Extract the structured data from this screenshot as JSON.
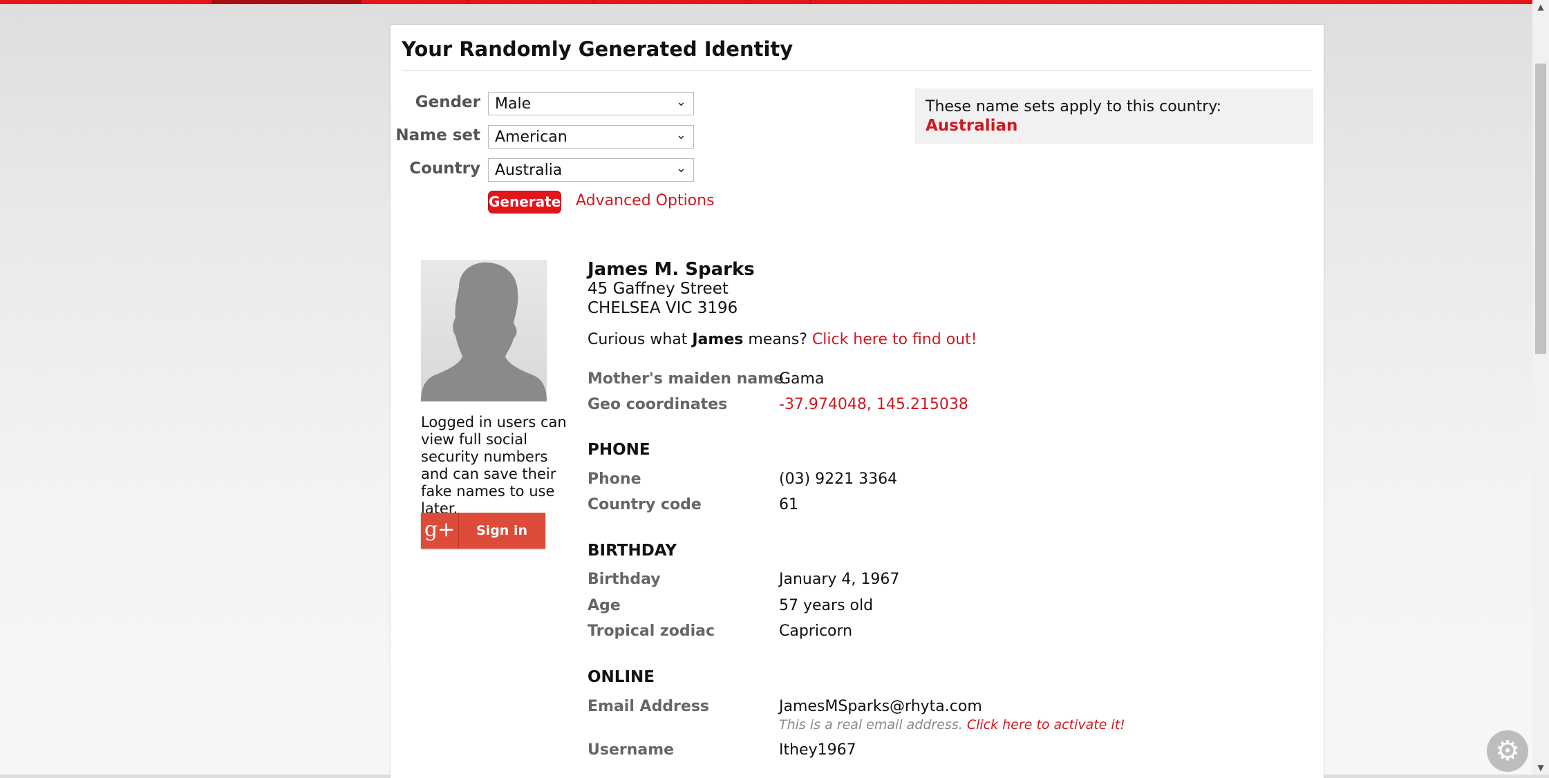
{
  "page": {
    "title": "Your Randomly Generated Identity"
  },
  "form": {
    "gender_label": "Gender",
    "gender_value": "Male",
    "nameset_label": "Name set",
    "nameset_value": "American",
    "country_label": "Country",
    "country_value": "Australia",
    "generate_label": "Generate",
    "advanced_label": "Advanced Options"
  },
  "note": {
    "text": "These name sets apply to this country:",
    "value": "Australian"
  },
  "sidebar": {
    "login_note": "Logged in users can view full social security numbers and can save their fake names to use later.",
    "google_icon": "g+",
    "signin_label": "Sign in"
  },
  "identity": {
    "name": "James M. Sparks",
    "street": "45 Gaffney Street",
    "city": "CHELSEA VIC 3196",
    "curious_prefix": "Curious what",
    "curious_name": "James",
    "curious_mid": "means?",
    "curious_link": "Click here to find out!",
    "maiden_label": "Mother's maiden name",
    "maiden_value": "Gama",
    "geo_label": "Geo coordinates",
    "geo_value": "-37.974048, 145.215038"
  },
  "phone": {
    "heading": "PHONE",
    "phone_label": "Phone",
    "phone_value": "(03) 9221 3364",
    "cc_label": "Country code",
    "cc_value": "61"
  },
  "birthday": {
    "heading": "BIRTHDAY",
    "birthday_label": "Birthday",
    "birthday_value": "January 4, 1967",
    "age_label": "Age",
    "age_value": "57 years old",
    "zodiac_label": "Tropical zodiac",
    "zodiac_value": "Capricorn"
  },
  "online": {
    "heading": "ONLINE",
    "email_label": "Email Address",
    "email_value": "JamesMSparks@rhyta.com",
    "email_note": "This is a real email address.",
    "email_link": "Click here to activate it!",
    "username_label": "Username",
    "username_value": "Ithey1967"
  },
  "colors": {
    "accent": "#e4141b",
    "link": "#d0181f"
  },
  "icons": {
    "chevron": "chevron-down-icon",
    "settings": "gear-icon",
    "avatar": "person-silhouette-icon"
  }
}
